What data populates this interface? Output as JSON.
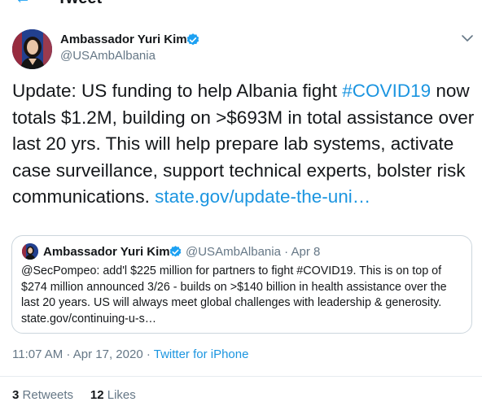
{
  "header": {
    "title": "Tweet"
  },
  "author": {
    "name": "Ambassador Yuri Kim",
    "handle": "@USAmbAlbania"
  },
  "tweet": {
    "text_1": "Update: US funding to help Albania fight ",
    "hashtag": "#COVID19",
    "text_2": " now totals $1.2M, building on >$693M in total assistance over last 20 yrs. This will help prepare lab systems, activate case surveillance, support technical experts, bolster risk communications. ",
    "link": "state.gov/update-the-uni…"
  },
  "quote": {
    "name": "Ambassador Yuri Kim",
    "handle": "@USAmbAlbania",
    "separator": " · ",
    "date": "Apr 8",
    "text": "@SecPompeo: add'l $225 million for partners to fight #COVID19. This is on top of $274 million announced 3/26 - builds on >$140 billion in health assistance over the last 20 years. US will always meet global challenges with leadership & generosity. state.gov/continuing-u-s…"
  },
  "meta": {
    "time": "11:07 AM · Apr 17, 2020 · ",
    "source": "Twitter for iPhone"
  },
  "stats": {
    "retweets_count": "3",
    "retweets_label": "Retweets",
    "likes_count": "12",
    "likes_label": "Likes"
  },
  "colors": {
    "accent": "#1da1f2",
    "link": "#1b95e0",
    "secondary_text": "#657786",
    "border": "#ccd6dd"
  }
}
